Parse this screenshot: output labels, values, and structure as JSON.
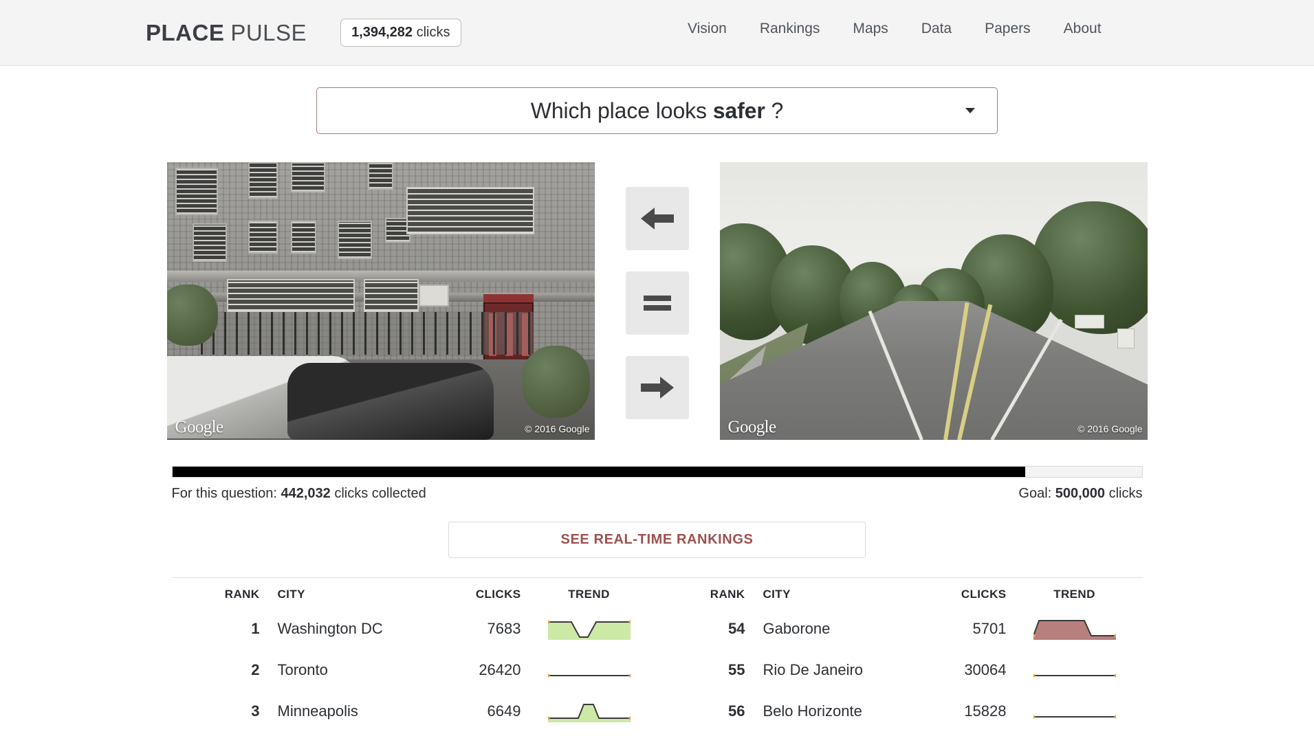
{
  "header": {
    "brand_bold": "PLACE",
    "brand_light": "PULSE",
    "clicks_count": "1,394,282",
    "clicks_word": "clicks",
    "nav": [
      {
        "label": "Vision"
      },
      {
        "label": "Rankings"
      },
      {
        "label": "Maps"
      },
      {
        "label": "Data"
      },
      {
        "label": "Papers"
      },
      {
        "label": "About"
      }
    ]
  },
  "question": {
    "prefix": "Which place looks ",
    "attribute": "safer",
    "suffix": " ?",
    "caret_icon": "chevron-down-icon",
    "border_color": "#a9797c"
  },
  "compare": {
    "left_photo": {
      "watermark": "Google",
      "copyright": "© 2016 Google",
      "description": "grey apartment building with barred windows and parked cars"
    },
    "right_photo": {
      "watermark": "Google",
      "copyright": "© 2016 Google",
      "description": "tree-lined suburban road with yellow center lines"
    },
    "buttons": [
      {
        "name": "choose-left",
        "icon": "arrow-left-icon"
      },
      {
        "name": "choose-equal",
        "icon": "equals-icon"
      },
      {
        "name": "choose-right",
        "icon": "arrow-right-icon"
      }
    ]
  },
  "progress": {
    "percent": 88,
    "left_prefix": "For this question: ",
    "left_value": "442,032",
    "left_suffix": " clicks collected",
    "right_prefix": "Goal: ",
    "right_value": "500,000",
    "right_suffix": " clicks",
    "fill_color": "#000000"
  },
  "rankings_button": {
    "label": "SEE REAL-TIME RANKINGS",
    "text_color": "#9d4f4f"
  },
  "tables": {
    "columns": [
      "RANK",
      "CITY",
      "CLICKS",
      "TREND"
    ],
    "left_rows": [
      {
        "rank": "1",
        "city": "Washington DC",
        "clicks": "7683",
        "trend": "up"
      },
      {
        "rank": "2",
        "city": "Toronto",
        "clicks": "26420",
        "trend": "flat"
      },
      {
        "rank": "3",
        "city": "Minneapolis",
        "clicks": "6649",
        "trend": "bump"
      }
    ],
    "right_rows": [
      {
        "rank": "54",
        "city": "Gaborone",
        "clicks": "5701",
        "trend": "down"
      },
      {
        "rank": "55",
        "city": "Rio De Janeiro",
        "clicks": "30064",
        "trend": "flat"
      },
      {
        "rank": "56",
        "city": "Belo Horizonte",
        "clicks": "15828",
        "trend": "flat"
      }
    ],
    "trend_colors": {
      "positive_fill": "#cde9a6",
      "negative_fill": "#b87f7f",
      "stroke": "#3a3a3a",
      "point": "#e8a33d"
    }
  }
}
